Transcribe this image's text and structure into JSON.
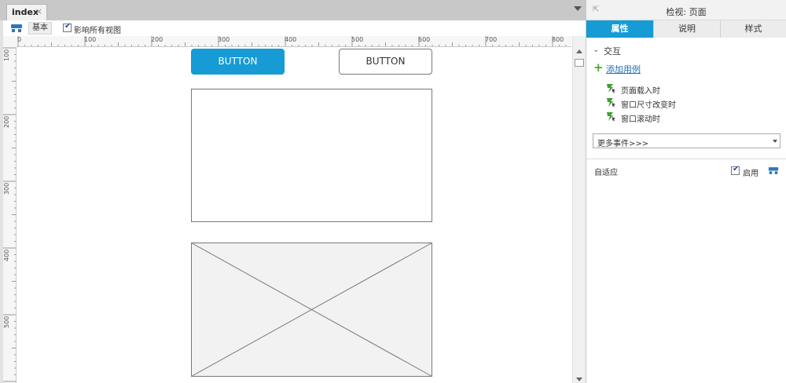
{
  "tabs": [
    {
      "label": "index",
      "close_glyph": "×",
      "active": true
    }
  ],
  "canvas_toolbar": {
    "view_label": "基本",
    "affect_all_label": "影响所有视图",
    "affect_all_checked": true
  },
  "rulers": {
    "horizontal_labels": [
      "0",
      "100",
      "200",
      "300",
      "400",
      "500",
      "600",
      "700",
      "800"
    ],
    "vertical_labels": [
      "100",
      "200",
      "300",
      "400",
      "500"
    ]
  },
  "canvas": {
    "primary_button_label": "BUTTON",
    "default_button_label": "BUTTON",
    "primary_color": "#169bd5",
    "border_color": "#797979",
    "placeholder_fill": "#f2f2f2"
  },
  "inspector": {
    "title": "检视: 页面",
    "tabs": [
      "属性",
      "说明",
      "样式"
    ],
    "active_tab": "属性",
    "interaction": {
      "section_title": "交互",
      "add_case_label": "添加用例",
      "events": [
        "页面载入时",
        "窗口尺寸改变时",
        "窗口滚动时"
      ],
      "more_events_label": "更多事件>>>"
    },
    "adaptive": {
      "label": "自适应",
      "enable_label": "启用",
      "enabled": true
    }
  }
}
